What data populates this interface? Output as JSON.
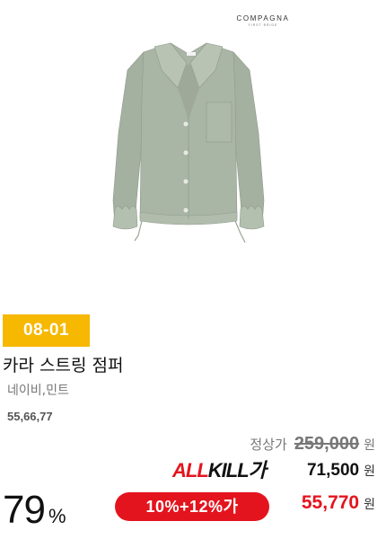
{
  "brand": {
    "name": "COMPAGNA",
    "sub": "FIRST BRIDE"
  },
  "product": {
    "badge": "08-01",
    "name": "카라 스트링 점퍼",
    "colors": "네이비,민트",
    "sizes": "55,66,77",
    "image": {
      "subject": "jacket",
      "color": "#a9b5a5"
    }
  },
  "pricing": {
    "regular_label": "정상가",
    "regular_price": "259,000",
    "currency": "원",
    "allkill_logo_part1": "ALL",
    "allkill_logo_part2": "KILL",
    "allkill_logo_part3": "가",
    "allkill_price": "71,500",
    "coupon_label": "10%+12%가",
    "final_price": "55,770",
    "discount_value": "79",
    "discount_unit": "%"
  },
  "colors": {
    "badge": "#f6b800",
    "accent_red": "#e4141e",
    "jacket": "#a9b5a5"
  }
}
